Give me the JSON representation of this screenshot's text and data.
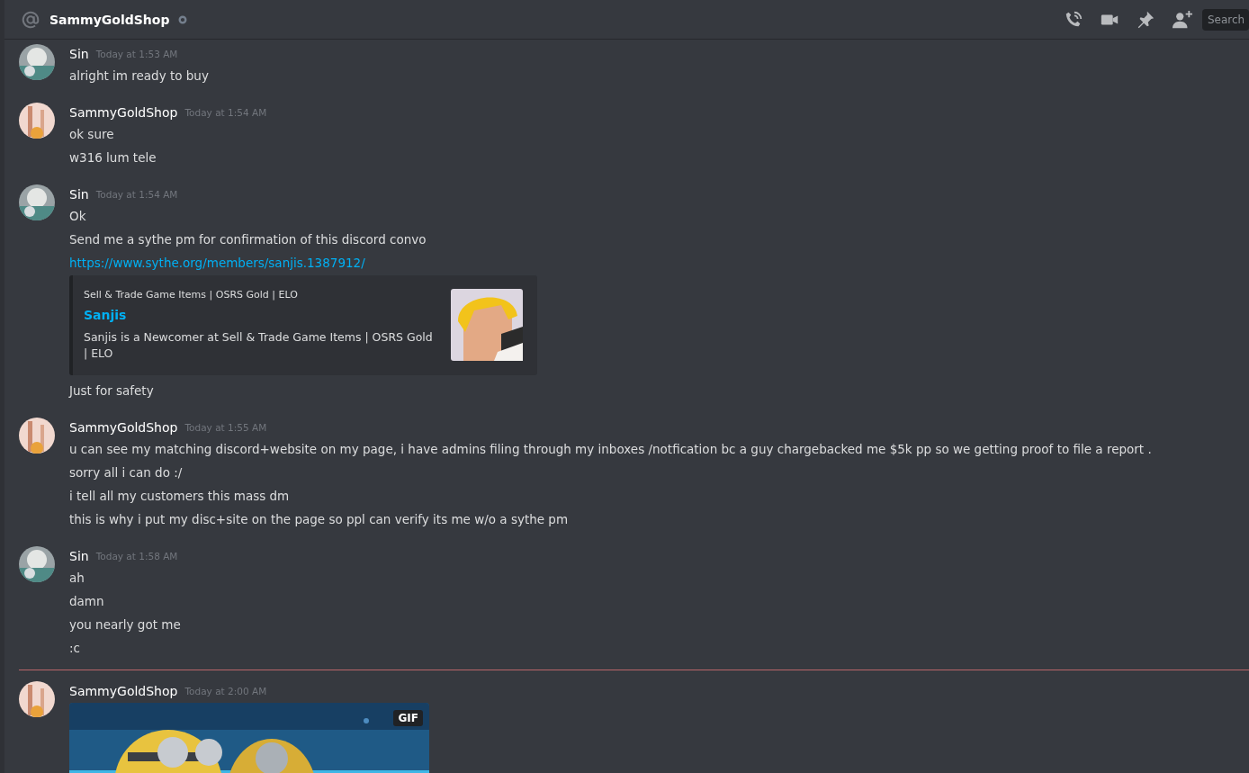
{
  "header": {
    "title": "SammyGoldShop",
    "search": {
      "placeholder": "Search"
    }
  },
  "messages": [
    {
      "author": "Sin",
      "time": "Today at 1:53 AM",
      "divider_before": false,
      "items": [
        {
          "kind": "text",
          "text": "alright im ready to buy"
        }
      ]
    },
    {
      "author": "SammyGoldShop",
      "time": "Today at 1:54 AM",
      "divider_before": false,
      "items": [
        {
          "kind": "text",
          "text": "ok sure"
        },
        {
          "kind": "text",
          "text": "w316 lum tele"
        }
      ]
    },
    {
      "author": "Sin",
      "time": "Today at 1:54 AM",
      "divider_before": false,
      "items": [
        {
          "kind": "text",
          "text": "Ok"
        },
        {
          "kind": "text",
          "text": "Send me a sythe pm for confirmation of this discord convo"
        },
        {
          "kind": "link",
          "text": "https://www.sythe.org/members/sanjis.1387912/"
        },
        {
          "kind": "embed",
          "provider": "Sell & Trade Game Items | OSRS Gold | ELO",
          "title": "Sanjis",
          "description": "Sanjis is a Newcomer at Sell & Trade Game Items | OSRS Gold | ELO"
        },
        {
          "kind": "text",
          "text": "Just for safety"
        }
      ]
    },
    {
      "author": "SammyGoldShop",
      "time": "Today at 1:55 AM",
      "divider_before": false,
      "items": [
        {
          "kind": "text",
          "text": "u can see my matching discord+website on my page, i have admins filing through my inboxes /notfication bc a guy chargebacked me $5k pp so we getting proof to file a report ."
        },
        {
          "kind": "text",
          "text": "sorry all i can do :/"
        },
        {
          "kind": "text",
          "text": "i tell all my customers this mass dm"
        },
        {
          "kind": "text",
          "text": "this is why i put my disc+site on the page so ppl can verify its me w/o a sythe pm"
        }
      ]
    },
    {
      "author": "Sin",
      "time": "Today at 1:58 AM",
      "divider_before": false,
      "items": [
        {
          "kind": "text",
          "text": "ah"
        },
        {
          "kind": "text",
          "text": "damn"
        },
        {
          "kind": "text",
          "text": "you nearly got me"
        },
        {
          "kind": "text",
          "text": ":c"
        }
      ]
    },
    {
      "author": "SammyGoldShop",
      "time": "Today at 2:00 AM",
      "divider_before": true,
      "items": [
        {
          "kind": "gif",
          "badge": "GIF"
        }
      ]
    }
  ]
}
